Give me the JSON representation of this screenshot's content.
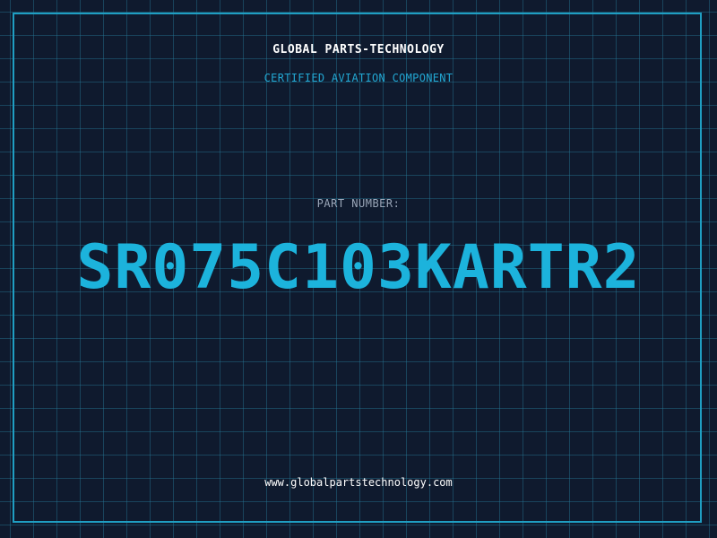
{
  "header": {
    "company_name": "GLOBAL PARTS-TECHNOLOGY",
    "tagline": "CERTIFIED AVIATION COMPONENT"
  },
  "part": {
    "label": "PART NUMBER:",
    "number": "SR075C103KARTR2"
  },
  "footer": {
    "website": "www.globalpartstechnology.com"
  },
  "colors": {
    "background": "#0f1a2e",
    "grid": "#26789a",
    "frame": "#1f9ec2",
    "accent": "#1cb3dc",
    "label": "#9aa6b8",
    "text": "#ffffff"
  }
}
